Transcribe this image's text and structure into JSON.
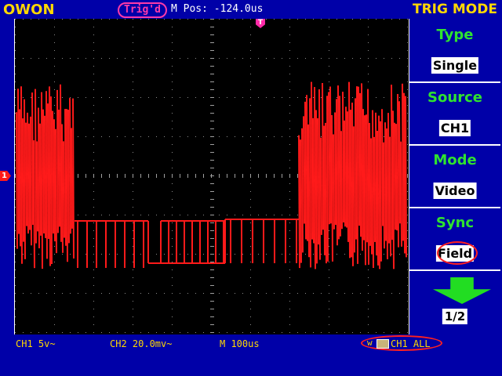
{
  "header": {
    "brand": "OWON",
    "trig_status": "Trig'd",
    "m_pos": "M Pos: -124.0us",
    "menu_title": "TRIG MODE"
  },
  "scope": {
    "trigger_marker": "T",
    "channel_marker": "1",
    "waveform_color": "#ff1a1a"
  },
  "sidebar": {
    "items": [
      {
        "label": "Type",
        "value": "Single",
        "highlighted": false
      },
      {
        "label": "Source",
        "value": "CH1",
        "highlighted": false
      },
      {
        "label": "Mode",
        "value": "Video",
        "highlighted": false
      },
      {
        "label": "Sync",
        "value": "Field",
        "highlighted": true
      }
    ],
    "next_icon": "down-arrow-icon",
    "page": "1/2"
  },
  "status": {
    "ch1": "CH1 5v~",
    "ch2": "CH2 20.0mv~",
    "timebase": "M 100us",
    "trigger_icon_letter": "w",
    "trigger_source": "CH1 ALL"
  },
  "colors": {
    "background": "#0000a8",
    "accent_yellow": "#ffd800",
    "accent_green": "#2fe32f",
    "highlight_red": "#ff2020"
  }
}
